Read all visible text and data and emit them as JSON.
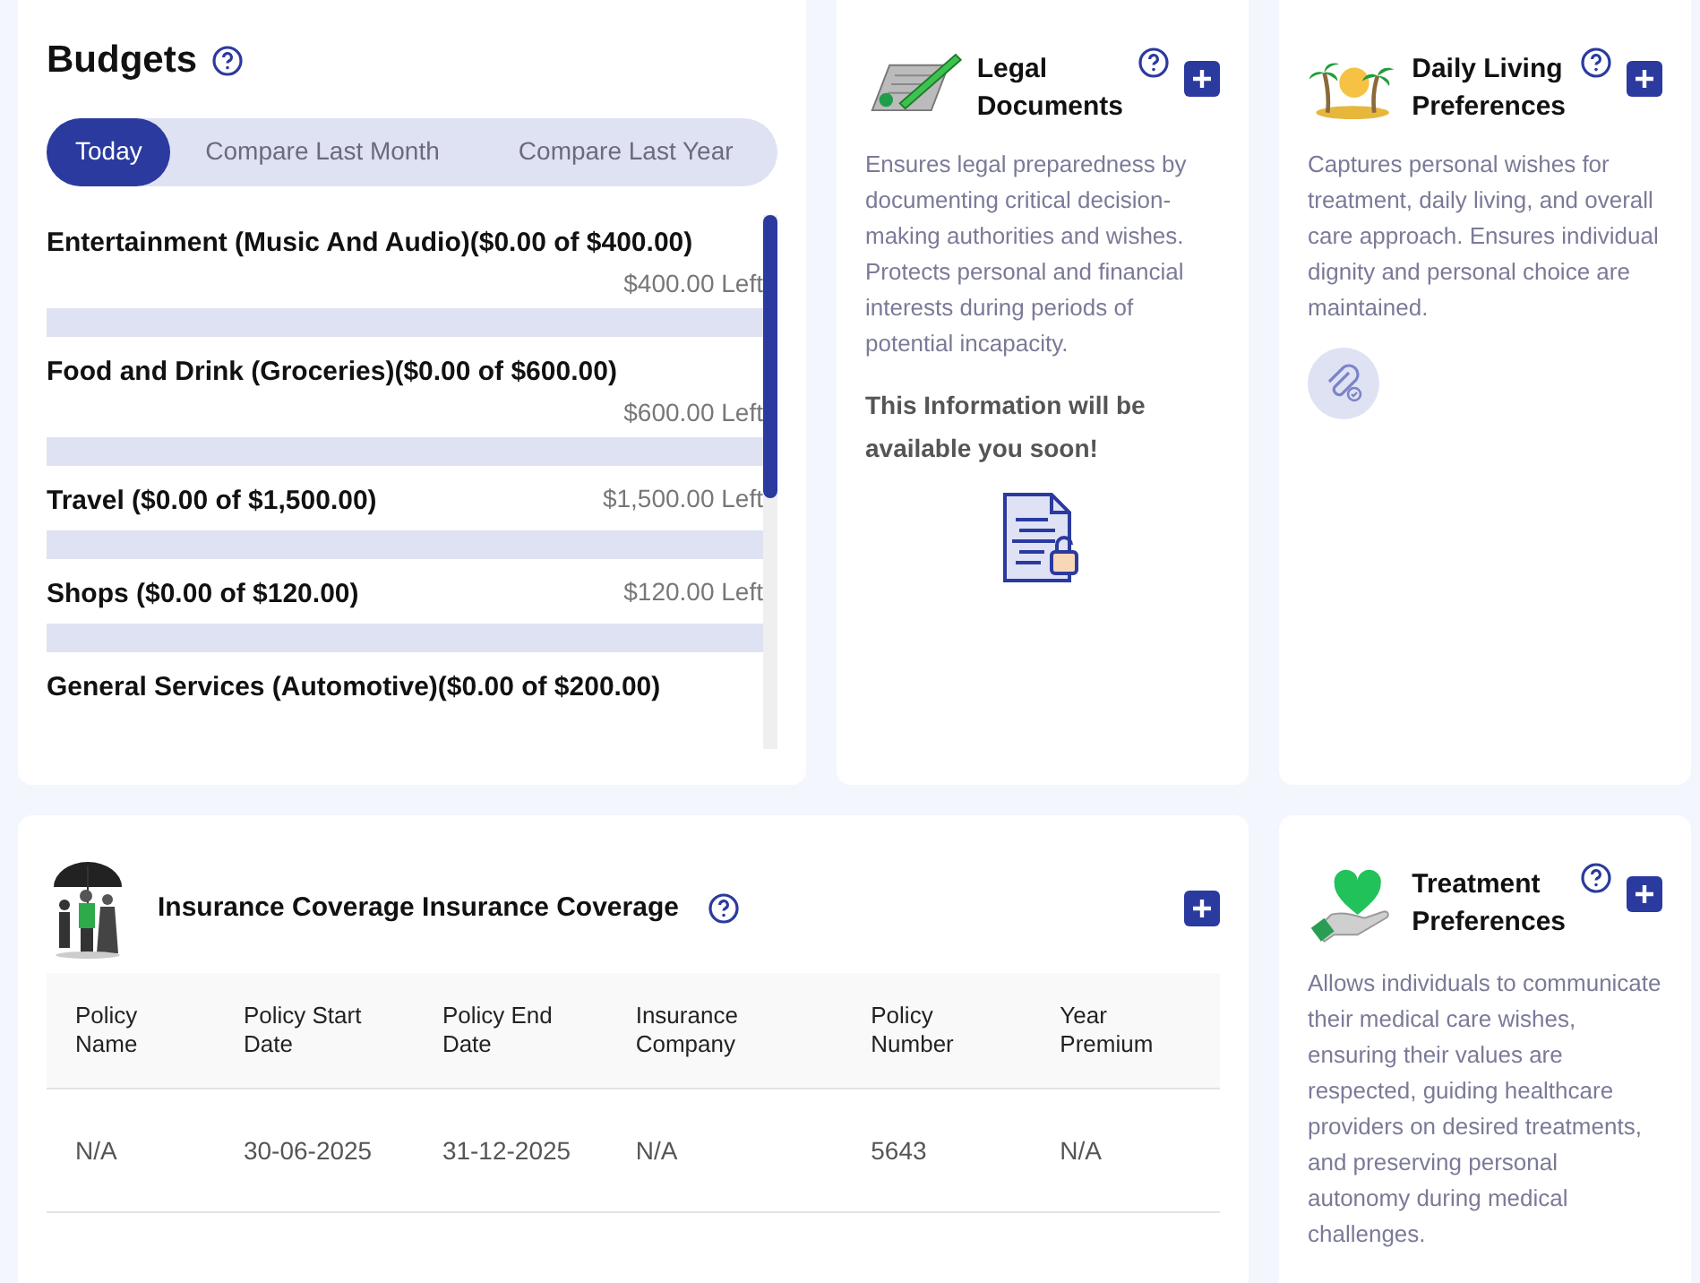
{
  "budgets": {
    "title": "Budgets",
    "tabs": [
      {
        "label": "Today",
        "selected": true
      },
      {
        "label": "Compare Last Month",
        "selected": false
      },
      {
        "label": "Compare Last Year",
        "selected": false
      }
    ],
    "items": [
      {
        "name": "Entertainment (Music And Audio)($0.00 of $400.00)",
        "left": "$400.00 Left",
        "level": 0
      },
      {
        "name": "Food and Drink (Groceries)($0.00 of $600.00)",
        "left": "$600.00 Left",
        "level": 0
      },
      {
        "name": "Travel ($0.00 of $1,500.00)",
        "left": "$1,500.00 Left",
        "level": 0
      },
      {
        "name": "Shops ($0.00 of $120.00)",
        "left": "$120.00 Left",
        "level": 0
      },
      {
        "name": "General Services (Automotive)($0.00 of $200.00)"
      }
    ]
  },
  "cards": [
    {
      "kind": "legal",
      "title": "Legal Documents",
      "description": "Ensures legal preparedness by documenting critical decision-making authorities and wishes. Protects personal and financial interests during periods of potential incapacity.",
      "notice": "This Information will be available you soon!"
    },
    {
      "kind": "palm",
      "title": "Daily Living Preferences",
      "description": "Captures personal wishes for treatment, daily living, and overall care approach. Ensures individual dignity and personal choice are maintained."
    }
  ],
  "insurance": {
    "title": "Insurance Coverage Insurance Coverage",
    "columns": [
      "Policy Name",
      "Policy Start Date",
      "Policy End Date",
      "Insurance Company",
      "Policy Number",
      "Year Premium"
    ],
    "rows": [
      [
        "N/A",
        "30-06-2025",
        "31-12-2025",
        "N/A",
        "5643",
        "N/A"
      ]
    ]
  },
  "treatment": {
    "kind": "heart",
    "title": "Treatment Preferences",
    "description": "Allows individuals to communicate their medical care wishes, ensuring their values are respected, guiding healthcare providers on desired treatments, and preserving personal autonomy during medical challenges."
  }
}
